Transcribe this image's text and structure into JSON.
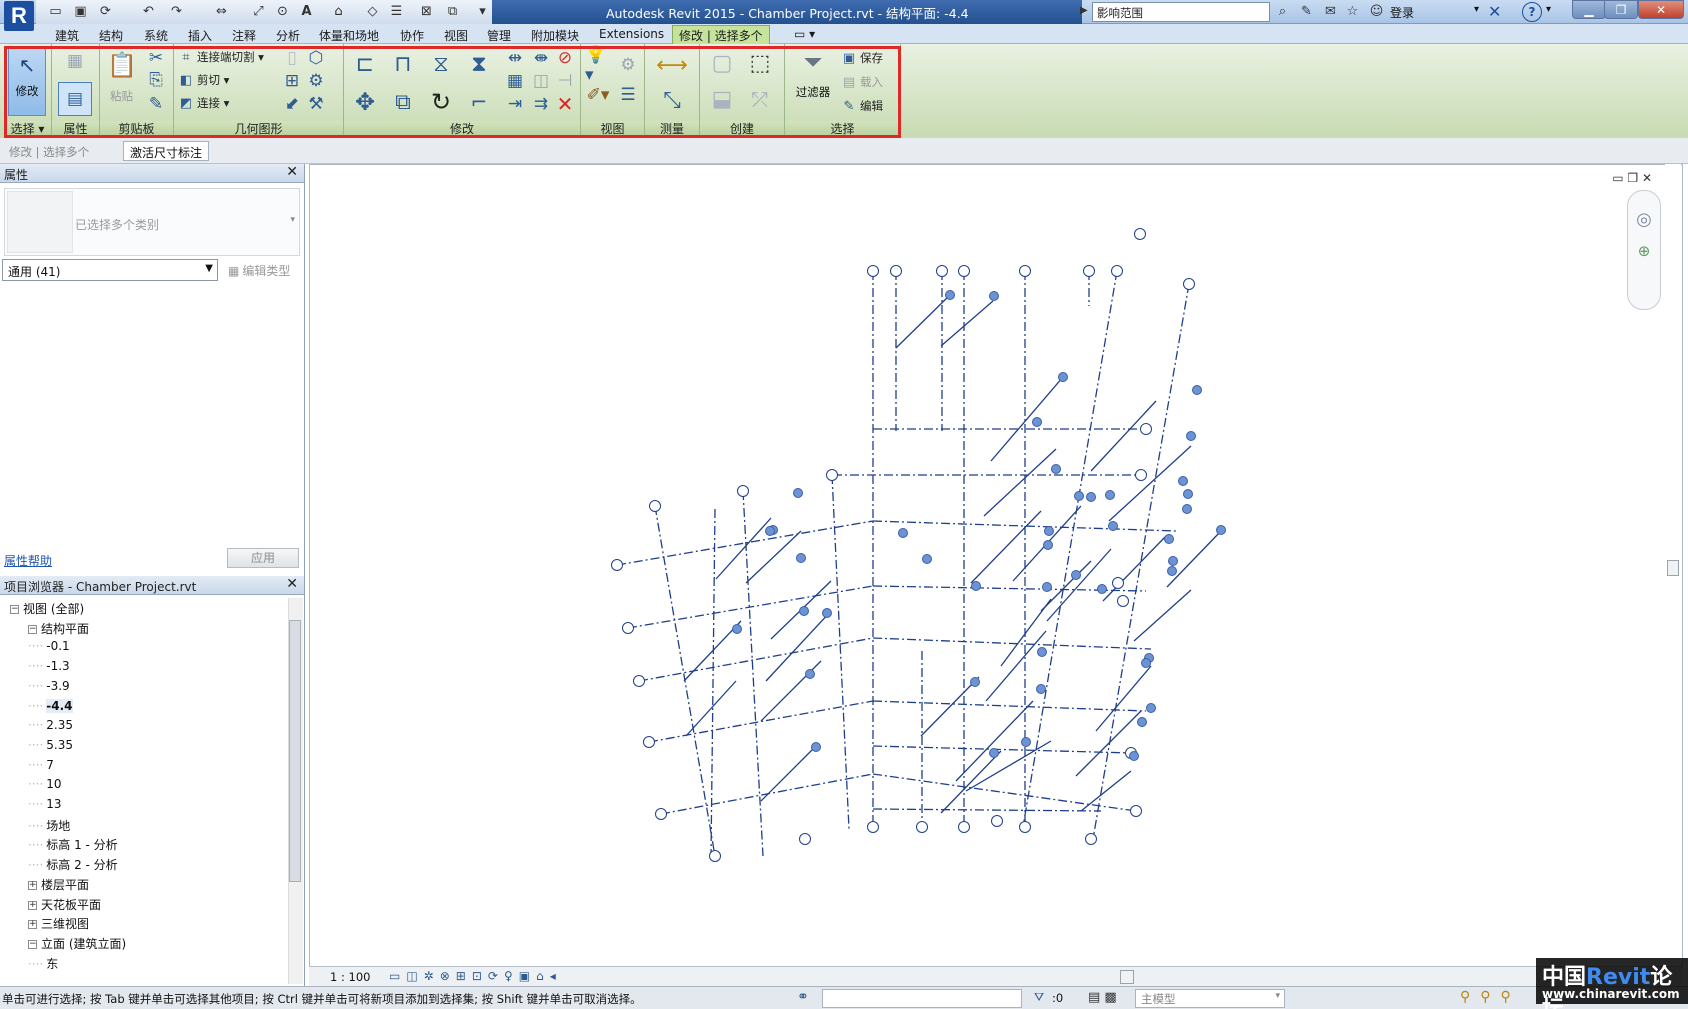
{
  "app": {
    "title": "Autodesk Revit 2015 -     Chamber Project.rvt - 结构平面: -4.4",
    "logo_letter": "R",
    "search_placeholder": "影响范围",
    "login_label": "登录"
  },
  "ribbon_tabs": [
    "建筑",
    "结构",
    "系统",
    "插入",
    "注释",
    "分析",
    "体量和场地",
    "协作",
    "视图",
    "管理",
    "附加模块",
    "Extensions",
    "修改 | 选择多个"
  ],
  "ribbon": {
    "modify_btn": "修改",
    "paste_btn": "粘贴",
    "cope_btn": "连接端切割",
    "cut_btn": "剪切",
    "join_btn": "连接",
    "filter_btn": "过滤器",
    "save_btn": "保存",
    "load_btn": "载入",
    "edit_btn": "编辑",
    "panels": {
      "select": "选择",
      "properties": "属性",
      "clipboard": "剪贴板",
      "geometry": "几何图形",
      "modify": "修改",
      "view": "视图",
      "measure": "测量",
      "create": "创建",
      "selection": "选择"
    },
    "accent": "#c6e39b",
    "highlight_color": "#e02828"
  },
  "options_bar": {
    "crumb": "修改 | 选择多个",
    "activate_dim": "激活尺寸标注"
  },
  "properties": {
    "header": "属性",
    "type_label": "已选择多个类别",
    "filter_value": "通用 (41)",
    "edit_type": "编辑类型",
    "help_link": "属性帮助",
    "apply_btn": "应用"
  },
  "browser": {
    "header": "项目浏览器 - Chamber Project.rvt",
    "rows": [
      {
        "label": "视图 (全部)",
        "toggle": "−"
      },
      {
        "label": "结构平面",
        "toggle": "−"
      },
      {
        "label": "-0.1",
        "toggle": ""
      },
      {
        "label": "-1.3",
        "toggle": ""
      },
      {
        "label": "-3.9",
        "toggle": ""
      },
      {
        "label": "-4.4",
        "toggle": ""
      },
      {
        "label": "2.35",
        "toggle": ""
      },
      {
        "label": "5.35",
        "toggle": ""
      },
      {
        "label": "7",
        "toggle": ""
      },
      {
        "label": "10",
        "toggle": ""
      },
      {
        "label": "13",
        "toggle": ""
      },
      {
        "label": "场地",
        "toggle": ""
      },
      {
        "label": "标高 1 - 分析",
        "toggle": ""
      },
      {
        "label": "标高 2 - 分析",
        "toggle": ""
      },
      {
        "label": "楼层平面",
        "toggle": "+"
      },
      {
        "label": "天花板平面",
        "toggle": "+"
      },
      {
        "label": "三维视图",
        "toggle": "+"
      },
      {
        "label": "立面 (建筑立面)",
        "toggle": "−"
      },
      {
        "label": "东",
        "toggle": ""
      }
    ],
    "selected": "-4.4"
  },
  "view_bar": {
    "scale": "1 : 100"
  },
  "status": {
    "message": "单击可进行选择; 按 Tab 键并单击可选择其他项目; 按 Ctrl 键并单击可将新项目添加到选择集; 按 Shift 键并单击可取消选择。",
    "count": ":0",
    "model": "主模型"
  },
  "watermark": {
    "line1_a": "中国",
    "line1_b": "Revit",
    "line1_c": "论坛",
    "line2": "www.chinarevit.com"
  },
  "drawing": {
    "line_color": "#1f3f8a",
    "bubble_color": "#6c93d4"
  }
}
